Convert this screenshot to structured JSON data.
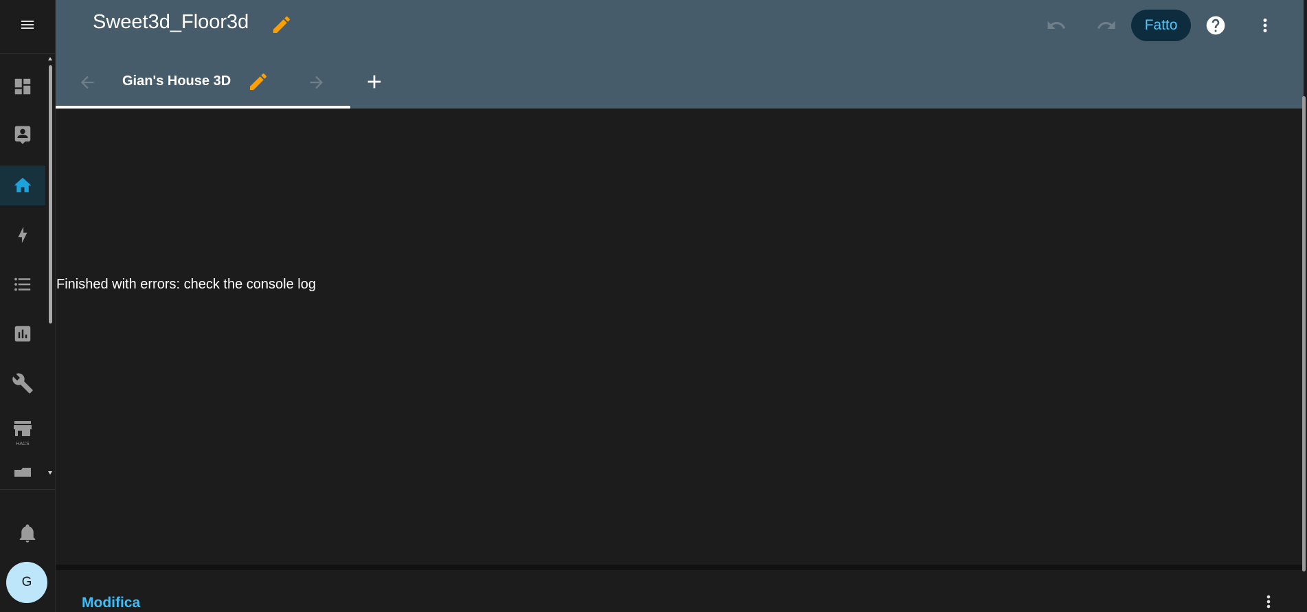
{
  "colors": {
    "header_bg": "#475c6b",
    "page_bg": "#1c1c1c",
    "accent_blue": "#41bdf5",
    "edit_orange": "#ffa000",
    "active_nav_bg": "#18323d"
  },
  "header": {
    "title": "Sweet3d_Floor3d",
    "done_label": "Fatto",
    "icons": [
      "edit-pencil-icon",
      "undo-icon",
      "redo-icon",
      "help-icon",
      "more-vert-icon"
    ]
  },
  "tabs": [
    {
      "label": "Gian's House 3D",
      "active": true
    }
  ],
  "sidebar": {
    "items": [
      {
        "name": "dashboard-icon"
      },
      {
        "name": "person-card-icon"
      },
      {
        "name": "home-icon",
        "active": true
      },
      {
        "name": "lightning-icon"
      },
      {
        "name": "list-icon"
      },
      {
        "name": "chart-icon"
      },
      {
        "name": "wrench-icon"
      },
      {
        "name": "hacs-store-icon",
        "label": "HACS"
      }
    ],
    "notifications_icon": "bell-icon",
    "avatar_initial": "G"
  },
  "main": {
    "message": "Finished with errors: check the console log"
  },
  "footer": {
    "edit_label": "Modifica"
  }
}
